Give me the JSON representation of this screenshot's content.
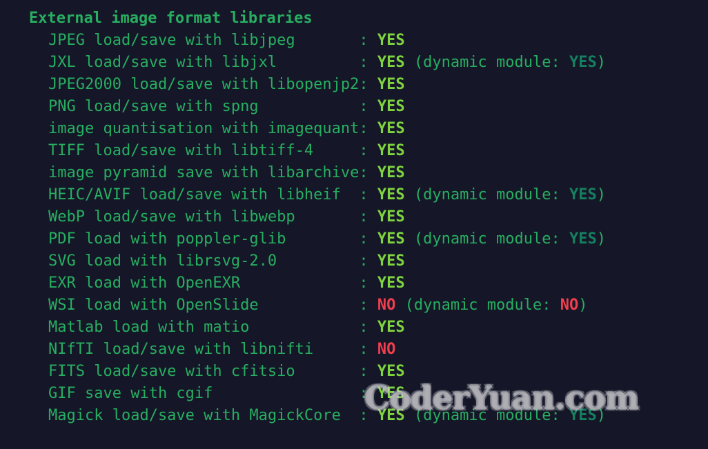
{
  "terminal": {
    "background_color": "#151728",
    "header": "External image format libraries",
    "label_color": "#27ae60",
    "yes_color": "#7ed33f",
    "no_color": "#ef3e4d",
    "dynamic_yes_color": "#15805f",
    "separator": ":",
    "dynamic_prefix": "(dynamic module:",
    "dynamic_suffix": ")",
    "label_column_width": 34,
    "entries": [
      {
        "label": "JPEG load/save with libjpeg",
        "status": "YES",
        "dynamic": null
      },
      {
        "label": "JXL load/save with libjxl",
        "status": "YES",
        "dynamic": "YES"
      },
      {
        "label": "JPEG2000 load/save with libopenjp2",
        "status": "YES",
        "dynamic": null
      },
      {
        "label": "PNG load/save with spng",
        "status": "YES",
        "dynamic": null
      },
      {
        "label": "image quantisation with imagequant",
        "status": "YES",
        "dynamic": null
      },
      {
        "label": "TIFF load/save with libtiff-4",
        "status": "YES",
        "dynamic": null
      },
      {
        "label": "image pyramid save with libarchive",
        "status": "YES",
        "dynamic": null
      },
      {
        "label": "HEIC/AVIF load/save with libheif",
        "status": "YES",
        "dynamic": "YES"
      },
      {
        "label": "WebP load/save with libwebp",
        "status": "YES",
        "dynamic": null
      },
      {
        "label": "PDF load with poppler-glib",
        "status": "YES",
        "dynamic": "YES"
      },
      {
        "label": "SVG load with librsvg-2.0",
        "status": "YES",
        "dynamic": null
      },
      {
        "label": "EXR load with OpenEXR",
        "status": "YES",
        "dynamic": null
      },
      {
        "label": "WSI load with OpenSlide",
        "status": "NO",
        "dynamic": "NO"
      },
      {
        "label": "Matlab load with matio",
        "status": "YES",
        "dynamic": null
      },
      {
        "label": "NIfTI load/save with libnifti",
        "status": "NO",
        "dynamic": null
      },
      {
        "label": "FITS load/save with cfitsio",
        "status": "YES",
        "dynamic": null
      },
      {
        "label": "GIF save with cgif",
        "status": "YES",
        "dynamic": null
      },
      {
        "label": "Magick load/save with MagickCore",
        "status": "YES",
        "dynamic": "YES"
      }
    ]
  },
  "watermark": {
    "text": "CoderYuan.com",
    "color": "#acacb2"
  }
}
